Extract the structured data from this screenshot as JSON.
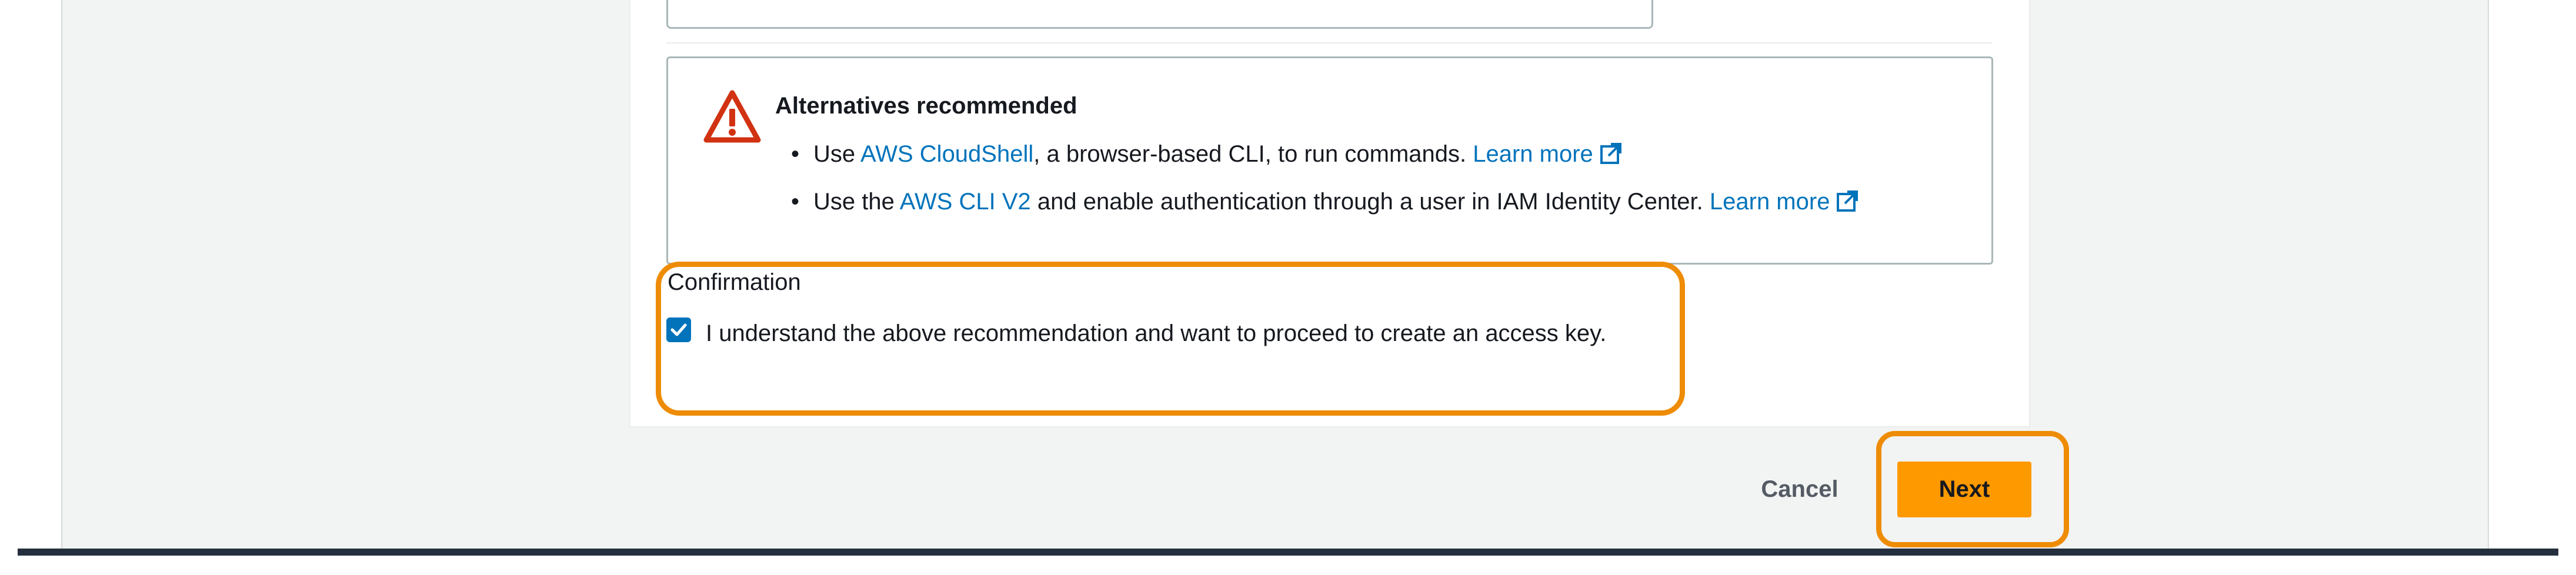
{
  "alert": {
    "title": "Alternatives recommended",
    "items": [
      {
        "prefix": "Use ",
        "link_text": "AWS CloudShell",
        "suffix": ", a browser-based CLI, to run commands. ",
        "learn_more": "Learn more"
      },
      {
        "prefix": "Use the ",
        "link_text": "AWS CLI V2",
        "suffix": " and enable authentication through a user in IAM Identity Center. ",
        "learn_more": "Learn more"
      }
    ],
    "icon": "warning-triangle-icon",
    "icon_color": "#d13212"
  },
  "confirmation": {
    "label": "Confirmation",
    "checkbox_checked": true,
    "checkbox_text": "I understand the above recommendation and want to proceed to create an access key."
  },
  "actions": {
    "cancel_label": "Cancel",
    "next_label": "Next"
  },
  "colors": {
    "accent": "#ff9900",
    "link": "#0073bb",
    "highlight": "#ee8c06",
    "bottom_bar": "#232f3e"
  }
}
